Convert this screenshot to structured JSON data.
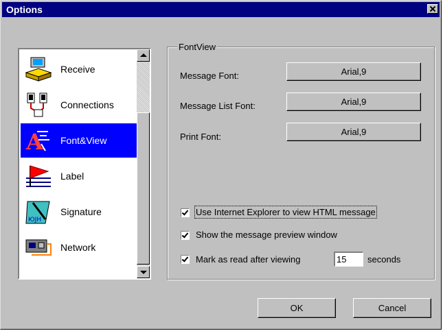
{
  "window": {
    "title": "Options"
  },
  "categories": [
    {
      "label": "Receive",
      "icon": "receive-icon"
    },
    {
      "label": "Connections",
      "icon": "connections-icon"
    },
    {
      "label": "Font&View",
      "icon": "font-view-icon",
      "selected": true
    },
    {
      "label": "Label",
      "icon": "label-flag-icon"
    },
    {
      "label": "Signature",
      "icon": "signature-icon"
    },
    {
      "label": "Network",
      "icon": "network-icon"
    }
  ],
  "group": {
    "title": "FontView",
    "message_font": {
      "label": "Message Font:",
      "value": "Arial,9"
    },
    "message_list_font": {
      "label": "Message List Font:",
      "value": "Arial,9"
    },
    "print_font": {
      "label": "Print Font:",
      "value": "Arial,9"
    }
  },
  "options": {
    "use_ie": {
      "label": "Use Internet Explorer to view HTML message",
      "checked": true
    },
    "preview": {
      "label": "Show the message preview window",
      "checked": true
    },
    "mark_read": {
      "label": "Mark as read after viewing",
      "checked": true,
      "seconds": "15",
      "suffix": "seconds"
    }
  },
  "buttons": {
    "ok": "OK",
    "cancel": "Cancel"
  },
  "colors": {
    "titlebar": "#000080",
    "selection": "#0000ff",
    "face": "#c0c0c0"
  }
}
